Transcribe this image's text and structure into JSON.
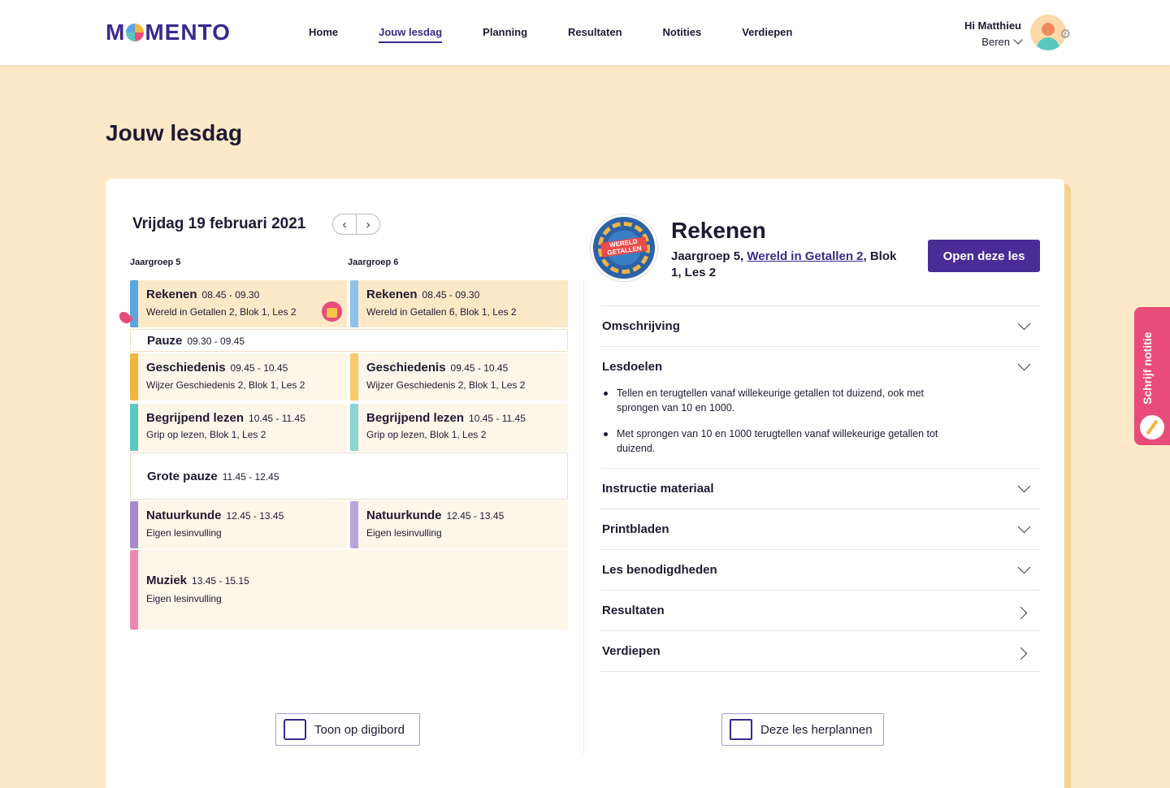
{
  "brand": {
    "logo_left": "M",
    "logo_right": "MENTO"
  },
  "nav": {
    "items": [
      {
        "label": "Home"
      },
      {
        "label": "Jouw lesdag",
        "active": true
      },
      {
        "label": "Planning"
      },
      {
        "label": "Resultaten"
      },
      {
        "label": "Notities"
      },
      {
        "label": "Verdiepen"
      }
    ]
  },
  "user": {
    "greeting": "Hi Matthieu",
    "group": "Beren"
  },
  "page": {
    "title": "Jouw lesdag"
  },
  "schedule": {
    "date": "Vrijdag 19 februari 2021",
    "columns": [
      "Jaargroep 5",
      "Jaargroep 6"
    ],
    "col5": [
      {
        "title": "Rekenen",
        "time": "08.45 - 09.30",
        "sub": "Wereld in Getallen 2, Blok 1, Les 2",
        "color": "#5aa6e0"
      },
      {
        "title": "Geschiedenis",
        "time": "09.45 - 10.45",
        "sub": "Wijzer Geschiedenis 2, Blok 1, Les 2",
        "color": "#f2b542"
      },
      {
        "title": "Begrijpend lezen",
        "time": "10.45 - 11.45",
        "sub": "Grip op lezen, Blok 1, Les 2",
        "color": "#5bc8c0"
      },
      {
        "title": "Natuurkunde",
        "time": "12.45 - 13.45",
        "sub": "Eigen lesinvulling",
        "color": "#a48ccc"
      },
      {
        "title": "Muziek",
        "time": "13.45 - 15.15",
        "sub": "Eigen lesinvulling",
        "color": "#ee87b0"
      }
    ],
    "col6": [
      {
        "title": "Rekenen",
        "time": "08.45 - 09.30",
        "sub": "Wereld in Getallen 6, Blok 1, Les 2",
        "color": "#8ec2ea"
      },
      {
        "title": "Geschiedenis",
        "time": "09.45 - 10.45",
        "sub": "Wijzer Geschiedenis 2, Blok 1, Les 2",
        "color": "#f7cc6e"
      },
      {
        "title": "Begrijpend lezen",
        "time": "10.45 - 11.45",
        "sub": "Grip op lezen, Blok 1, Les 2",
        "color": "#8ad6d0"
      },
      {
        "title": "Natuurkunde",
        "time": "12.45 - 13.45",
        "sub": "Eigen lesinvulling",
        "color": "#b7a4d8"
      }
    ],
    "breaks": [
      {
        "title": "Pauze",
        "time": "09.30 - 09.45"
      },
      {
        "title": "Grote pauze",
        "time": "11.45 - 12.45"
      }
    ],
    "digibord_button": "Toon op digibord"
  },
  "lesson": {
    "title": "Rekenen",
    "meta_prefix": "Jaargroep 5, ",
    "meta_link": "Wereld in Getallen 2",
    "meta_suffix": ", Blok 1, Les 2",
    "logo_text": "WERELD GETALLEN",
    "open_button": "Open deze les",
    "sections": [
      {
        "label": "Omschrijving"
      },
      {
        "label": "Lesdoelen"
      },
      {
        "label": "Instructie materiaal"
      },
      {
        "label": "Printbladen"
      },
      {
        "label": "Les benodigdheden"
      },
      {
        "label": "Resultaten"
      },
      {
        "label": "Verdiepen"
      }
    ],
    "goals": [
      "Tellen en terugtellen vanaf willekeurige getallen tot duizend, ook met sprongen van 10 en 1000.",
      "Met sprongen van 10 en 1000 terugtellen vanaf willekeurige getallen tot duizend."
    ],
    "reschedule_button": "Deze les herplannen"
  },
  "side_tab": {
    "label": "Schrijf notitie"
  }
}
